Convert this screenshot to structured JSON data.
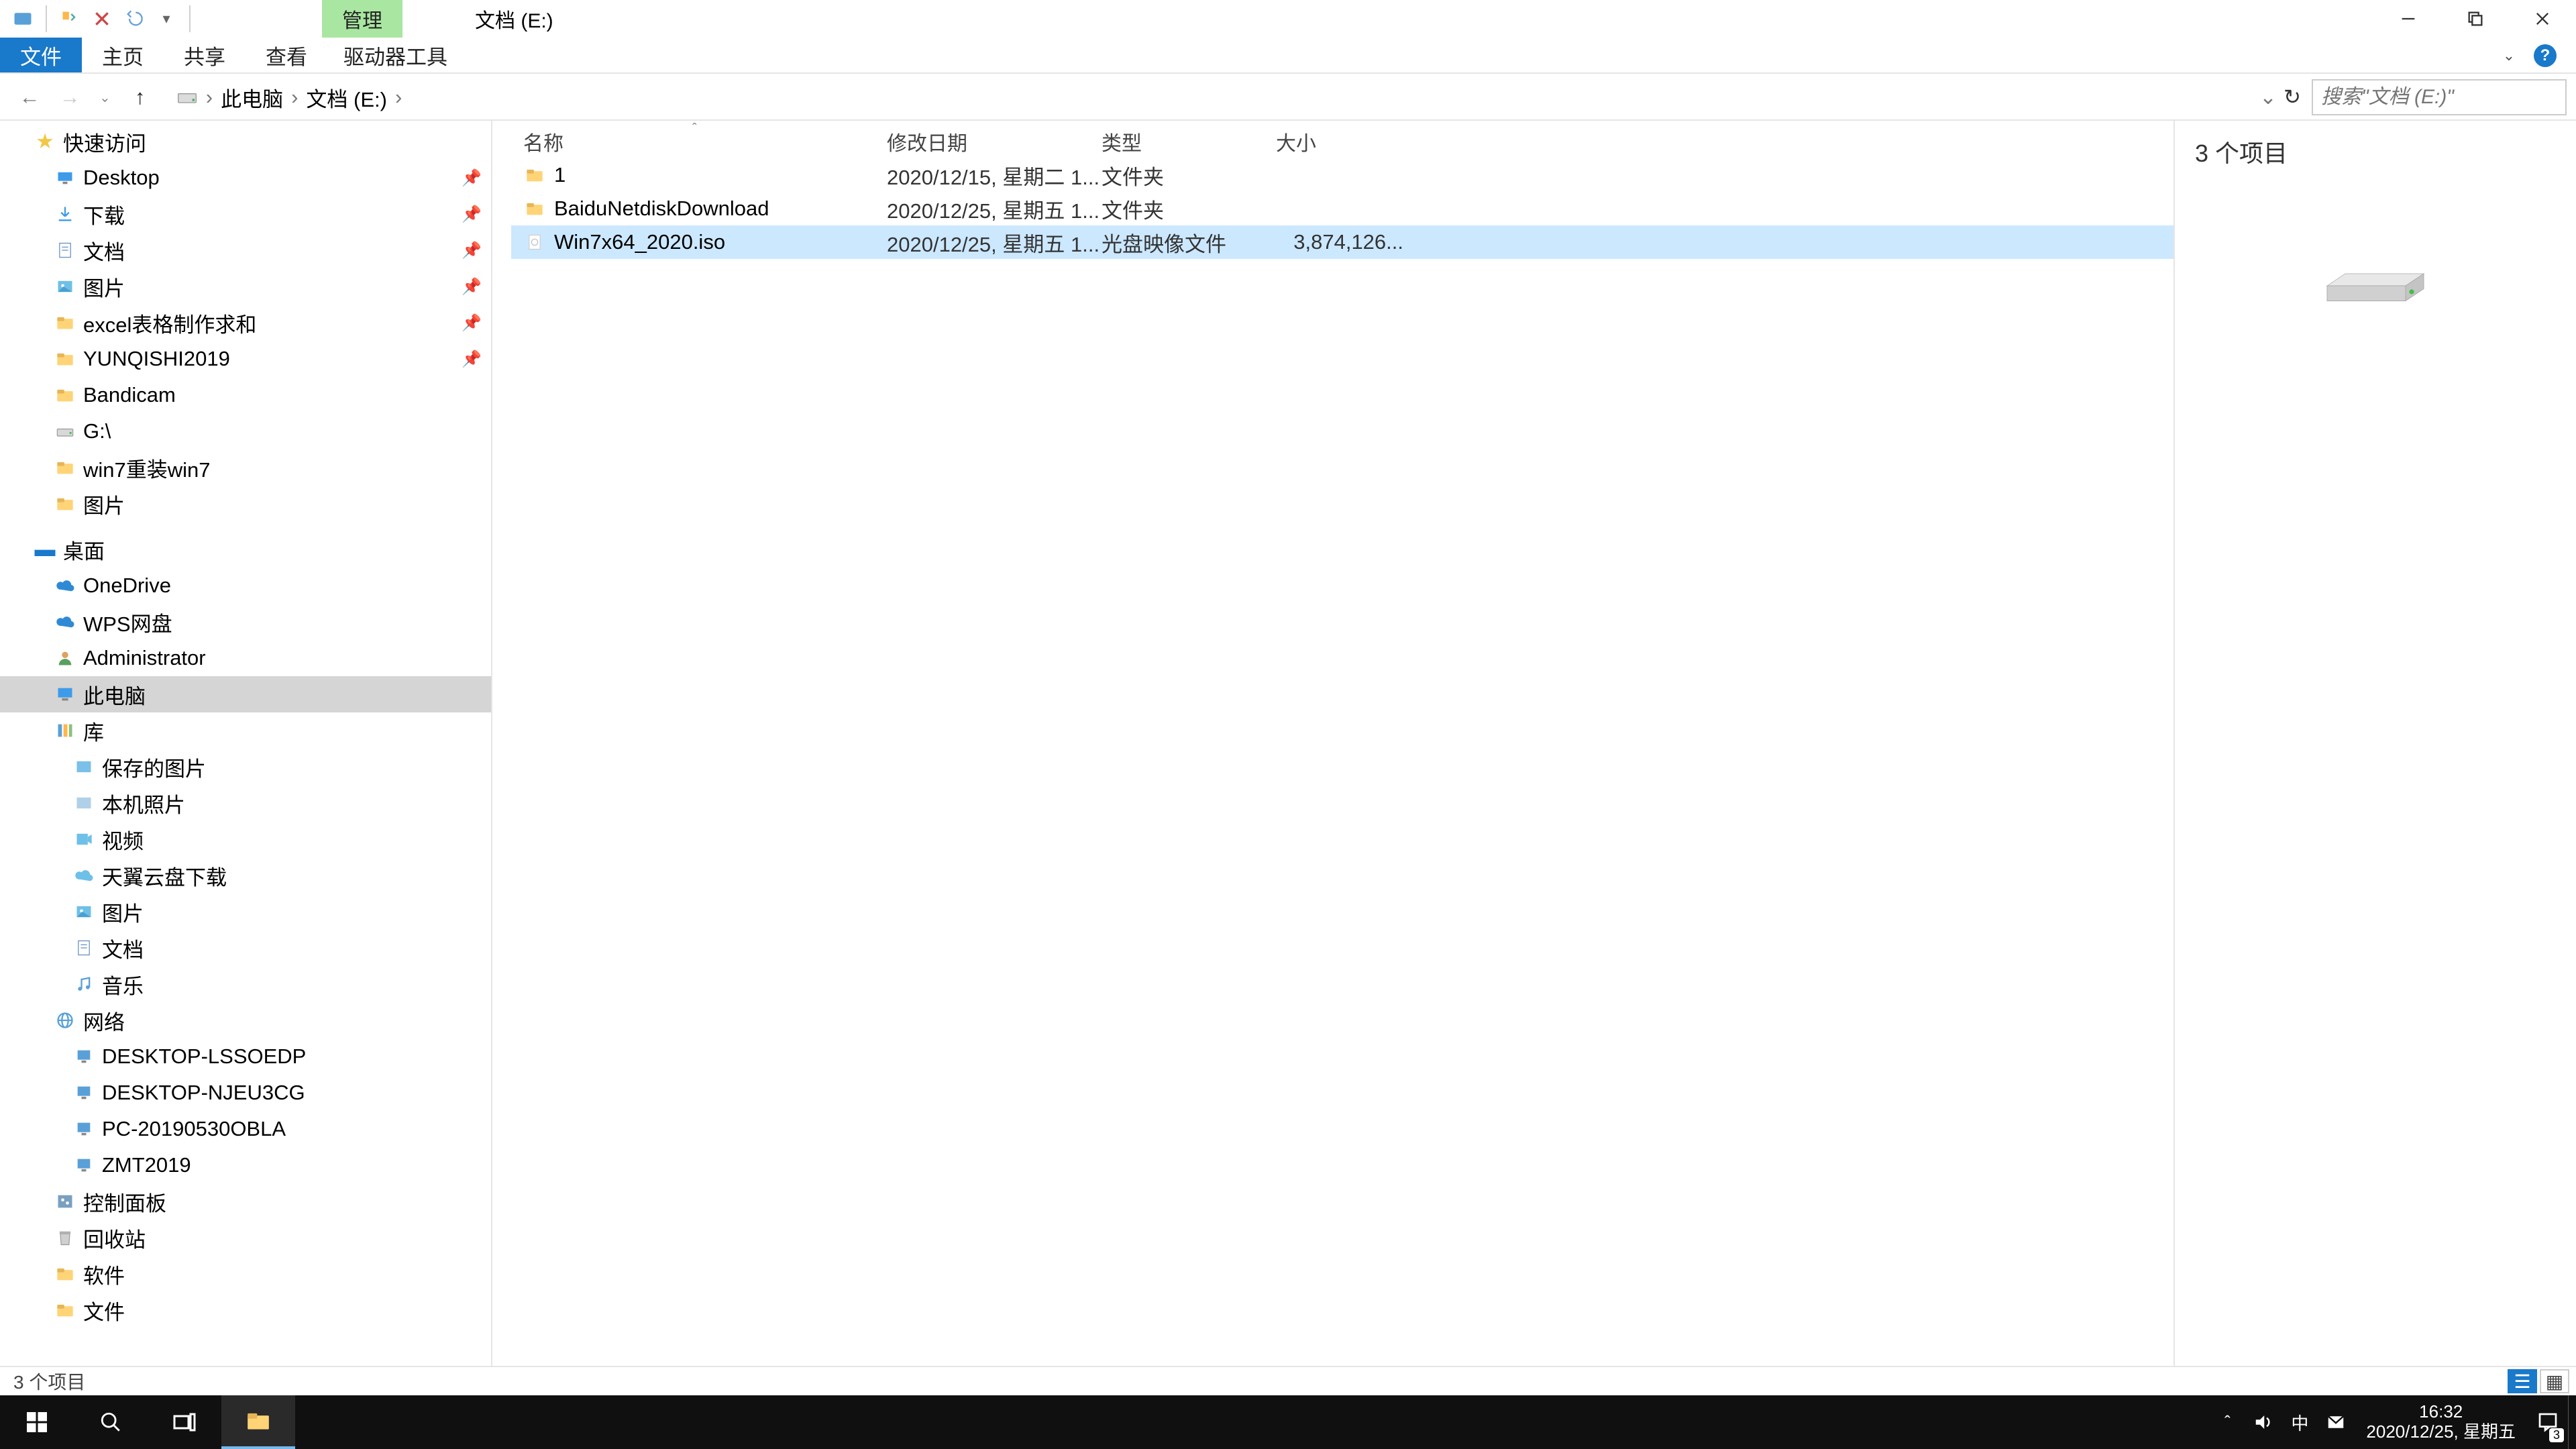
{
  "titlebar": {
    "context_tab": "管理",
    "location_title": "文档 (E:)"
  },
  "ribbon": {
    "file": "文件",
    "home": "主页",
    "share": "共享",
    "view": "查看",
    "drive_tools": "驱动器工具"
  },
  "nav": {
    "breadcrumb": [
      "此电脑",
      "文档 (E:)"
    ],
    "search_placeholder": "搜索\"文档 (E:)\""
  },
  "sidebar": {
    "quick_access": "快速访问",
    "quick_items": [
      {
        "label": "Desktop",
        "icon": "desktop"
      },
      {
        "label": "下载",
        "icon": "download"
      },
      {
        "label": "文档",
        "icon": "docs"
      },
      {
        "label": "图片",
        "icon": "pics"
      },
      {
        "label": "excel表格制作求和",
        "icon": "folder"
      },
      {
        "label": "YUNQISHI2019",
        "icon": "folder"
      },
      {
        "label": "Bandicam",
        "icon": "folder"
      },
      {
        "label": "G:\\",
        "icon": "drive"
      },
      {
        "label": "win7重装win7",
        "icon": "folder"
      },
      {
        "label": "图片",
        "icon": "folder"
      }
    ],
    "desktop_root": "桌面",
    "desktop_items": [
      {
        "label": "OneDrive",
        "icon": "cloud-blue"
      },
      {
        "label": "WPS网盘",
        "icon": "cloud-blue"
      },
      {
        "label": "Administrator",
        "icon": "user"
      },
      {
        "label": "此电脑",
        "icon": "pc",
        "selected": true
      },
      {
        "label": "库",
        "icon": "lib"
      },
      {
        "label": "保存的图片",
        "icon": "saved"
      },
      {
        "label": "本机照片",
        "icon": "photo"
      },
      {
        "label": "视频",
        "icon": "video"
      },
      {
        "label": "天翼云盘下载",
        "icon": "cloud"
      },
      {
        "label": "图片",
        "icon": "pics"
      },
      {
        "label": "文档",
        "icon": "docs"
      },
      {
        "label": "音乐",
        "icon": "music"
      },
      {
        "label": "网络",
        "icon": "net"
      },
      {
        "label": "DESKTOP-LSSOEDP",
        "icon": "host"
      },
      {
        "label": "DESKTOP-NJEU3CG",
        "icon": "host"
      },
      {
        "label": "PC-20190530OBLA",
        "icon": "host"
      },
      {
        "label": "ZMT2019",
        "icon": "host"
      },
      {
        "label": "控制面板",
        "icon": "panel"
      },
      {
        "label": "回收站",
        "icon": "bin"
      },
      {
        "label": "软件",
        "icon": "folder"
      },
      {
        "label": "文件",
        "icon": "folder"
      }
    ]
  },
  "columns": {
    "name": "名称",
    "date": "修改日期",
    "type": "类型",
    "size": "大小"
  },
  "files": [
    {
      "name": "1",
      "date": "2020/12/15, 星期二 1...",
      "type": "文件夹",
      "size": "",
      "icon": "folder",
      "selected": false
    },
    {
      "name": "BaiduNetdiskDownload",
      "date": "2020/12/25, 星期五 1...",
      "type": "文件夹",
      "size": "",
      "icon": "folder",
      "selected": false
    },
    {
      "name": "Win7x64_2020.iso",
      "date": "2020/12/25, 星期五 1...",
      "type": "光盘映像文件",
      "size": "3,874,126...",
      "icon": "iso",
      "selected": true
    }
  ],
  "preview": {
    "title": "3 个项目"
  },
  "statusbar": {
    "left": "3 个项目"
  },
  "taskbar": {
    "time": "16:32",
    "date": "2020/12/25, 星期五",
    "ime": "中",
    "notif_count": "3"
  }
}
